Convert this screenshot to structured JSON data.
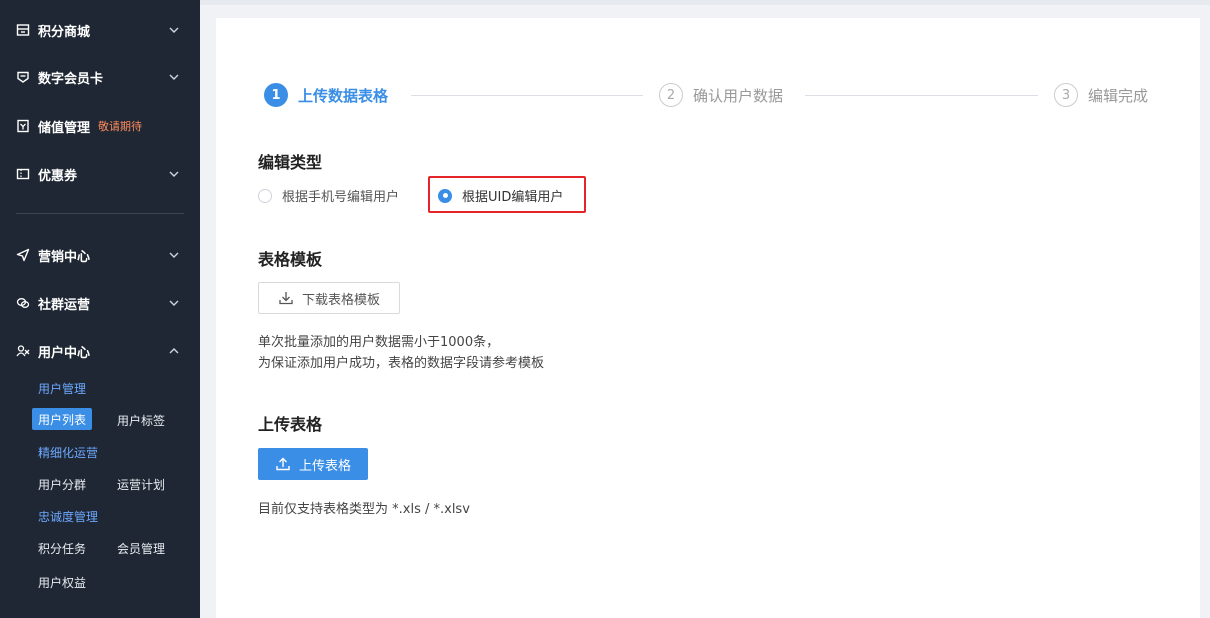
{
  "sidebar": {
    "points_mall": "积分商城",
    "digital_card": "数字会员卡",
    "stored_value": "储值管理",
    "stored_value_tag": "敬请期待",
    "coupon": "优惠券",
    "marketing": "营销中心",
    "community": "社群运营",
    "user_center": "用户中心",
    "user_mgmt": "用户管理",
    "user_list": "用户列表",
    "user_tags": "用户标签",
    "fine_ops": "精细化运营",
    "user_segment": "用户分群",
    "ops_plan": "运营计划",
    "loyalty": "忠诚度管理",
    "points_task": "积分任务",
    "member_mgmt": "会员管理",
    "user_rights": "用户权益"
  },
  "steps": [
    {
      "num": "1",
      "label": "上传数据表格"
    },
    {
      "num": "2",
      "label": "确认用户数据"
    },
    {
      "num": "3",
      "label": "编辑完成"
    }
  ],
  "edit_type": {
    "title": "编辑类型",
    "option_phone": "根据手机号编辑用户",
    "option_uid": "根据UID编辑用户"
  },
  "template": {
    "title": "表格模板",
    "download_label": "下载表格模板",
    "note_line1": "单次批量添加的用户数据需小于1000条，",
    "note_line2": "为保证添加用户成功，表格的数据字段请参考模板"
  },
  "upload": {
    "title": "上传表格",
    "button_label": "上传表格",
    "note": "目前仅支持表格类型为 *.xls / *.xlsv"
  },
  "colors": {
    "accent": "#3a8ee6",
    "sidebar_bg": "#1e2733",
    "highlight": "#e4262a"
  }
}
